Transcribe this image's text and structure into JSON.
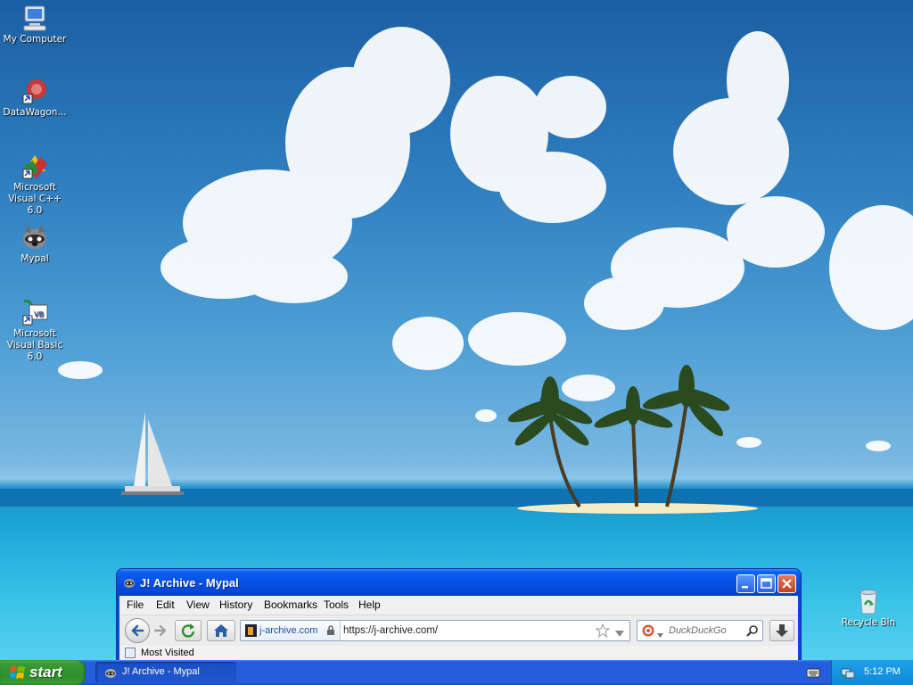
{
  "desktop": {
    "icons": [
      {
        "label": "My Computer",
        "icon": "my-computer-icon"
      },
      {
        "label": "DataWagon...",
        "icon": "datawagon-icon"
      },
      {
        "label": "Microsoft Visual C++ 6.0",
        "icon": "visual-cpp-icon"
      },
      {
        "label": "Mypal",
        "icon": "mypal-icon"
      },
      {
        "label": "Microsoft Visual Basic 6.0",
        "icon": "visual-basic-icon"
      },
      {
        "label": "Recycle Bin",
        "icon": "recycle-bin-icon"
      }
    ]
  },
  "window": {
    "title": "J! Archive - Mypal",
    "menu": [
      "File",
      "Edit",
      "View",
      "History",
      "Bookmarks",
      "Tools",
      "Help"
    ],
    "identity_site": "j-archive.com",
    "url": "https://j-archive.com/",
    "search_placeholder": "DuckDuckGo",
    "bookmarks_item": "Most Visited"
  },
  "taskbar": {
    "start_label": "start",
    "task_title": "J! Archive - Mypal",
    "clock": "5:12 PM"
  },
  "colors": {
    "titlebar": "#0650e6",
    "taskbar": "#245edc",
    "start": "#3a9a35",
    "tray": "#0f8ad8"
  }
}
